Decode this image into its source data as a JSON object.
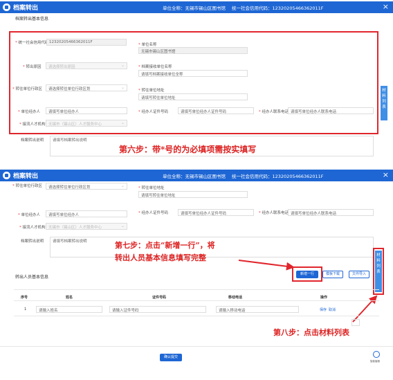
{
  "app_title": "档案转出",
  "unit_label": "单位全称：",
  "unit_name": "无锡市锡山区图书馆",
  "code_label": "统一社会信用代码：",
  "code_value": "12320205466362011F",
  "close_glyph": "×",
  "section_basic": "档案转出基本信息",
  "form": {
    "credit_code": {
      "label": "统一社会信用代码",
      "value": "12320205466362011F"
    },
    "unit_name": {
      "label": "单位名称",
      "value": "无锡市锡山区图书馆"
    },
    "reason": {
      "label": "转出原因",
      "placeholder": "请选择转出原因"
    },
    "receiver_name": {
      "label": "档案接收单位名称",
      "placeholder": "请填写档案接收单位全称"
    },
    "region": {
      "label": "转往单位行政区",
      "placeholder": "请选择转往单位行政区划"
    },
    "receiver_addr": {
      "label": "转往单位地址",
      "placeholder": "请填写转往单位地址"
    },
    "handler": {
      "label": "单位经办人",
      "placeholder": "请填写单位经办人"
    },
    "handler_id": {
      "label": "经办人证件号码",
      "placeholder": "请填写单位经办人证件号码"
    },
    "handler_phone": {
      "label": "经办人联系电话",
      "placeholder": "请填写单位经办人联系电话"
    },
    "talent_center": {
      "label": "接流人才机构",
      "placeholder": "无锡市（锡山区）人才服务中心"
    },
    "remark": {
      "label": "档案转出说明",
      "placeholder": "请填写档案转出说明"
    }
  },
  "side_tab_label": "材料列表",
  "step6": "第六步：带*号的为必填项需按实填写",
  "step7_line1": "第七步：点击“新增一行”，将",
  "step7_line2": "转出人员基本信息填写完整",
  "step8": "第八步：点击材料列表",
  "section_persons": "转出人员基本信息",
  "buttons": {
    "add_row": "新增一行",
    "template": "模板下载",
    "import": "文件导入",
    "submit": "确认提交"
  },
  "table": {
    "headers": [
      "序号",
      "姓名",
      "证件号码",
      "移动电话",
      "操作"
    ],
    "rows": [
      {
        "index": "1",
        "name_ph": "请输入姓名",
        "id_ph": "请输入证件号码",
        "phone_ph": "请输入移动电话",
        "save": "保存",
        "cancel": "取消"
      }
    ]
  },
  "service_label": "智能客服"
}
